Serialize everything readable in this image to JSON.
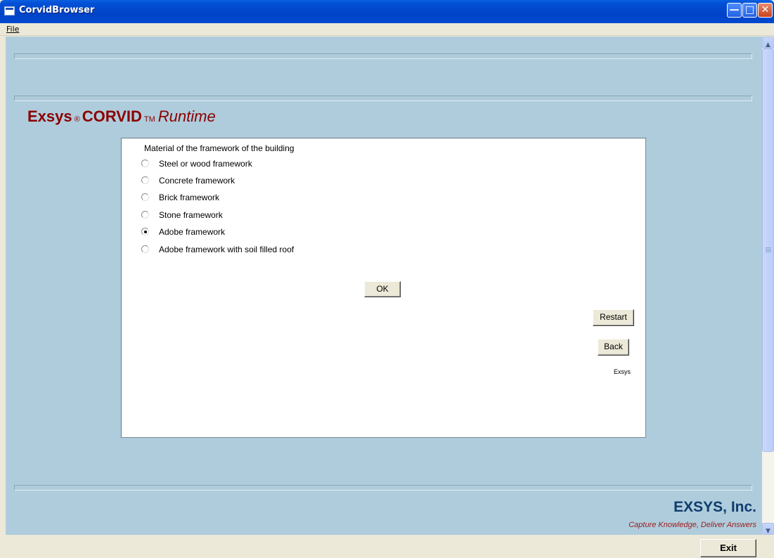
{
  "window": {
    "title": "CorvidBrowser",
    "minimize_icon": "minimize-icon",
    "maximize_icon": "maximize-icon",
    "close_icon": "close-icon"
  },
  "menu": {
    "file": "File"
  },
  "brand": {
    "name": "Exsys",
    "registered": "®",
    "product": "CORVID",
    "trademark": "TM",
    "mode": "Runtime"
  },
  "question": {
    "prompt": "Material of the framework of the building",
    "options": [
      {
        "label": "Steel or wood framework",
        "selected": false
      },
      {
        "label": "Concrete framework",
        "selected": false
      },
      {
        "label": "Brick framework",
        "selected": false
      },
      {
        "label": "Stone framework",
        "selected": false
      },
      {
        "label": "Adobe framework",
        "selected": true
      },
      {
        "label": "Adobe framework with soil filled roof",
        "selected": false
      }
    ]
  },
  "buttons": {
    "ok": "OK",
    "restart": "Restart",
    "back": "Back",
    "exit": "Exit"
  },
  "panel_footer": "Exsys",
  "footer": {
    "company": "EXSYS, Inc.",
    "tagline": "Capture Knowledge, Deliver Answers"
  },
  "colors": {
    "background": "#AFCCDC",
    "brand_red": "#8B0000",
    "company_blue": "#0F3D6E",
    "tagline_red": "#9B1C1C"
  }
}
